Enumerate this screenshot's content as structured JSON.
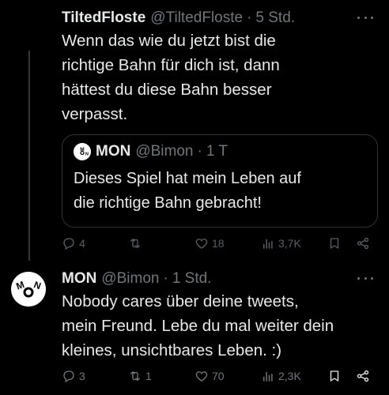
{
  "tweet1": {
    "name": "TiltedFloste",
    "handle": "@TiltedFloste",
    "dot": "·",
    "time": "5 Std.",
    "text_lines": [
      "Wenn das wie du jetzt bist die",
      "richtige Bahn für dich ist, dann",
      "hättest du diese Bahn besser",
      "verpasst."
    ],
    "quote": {
      "avatar_text": "MON",
      "name": "MON",
      "handle": "@Bimon",
      "dot": "·",
      "time": "1 T",
      "text_lines": [
        "Dieses Spiel hat mein Leben auf",
        "die richtige Bahn gebracht!"
      ]
    },
    "actions": {
      "replies": "4",
      "reposts": "",
      "likes": "18",
      "views": "3,7K"
    }
  },
  "tweet2": {
    "avatar_text": "MON",
    "name": "MON",
    "handle": "@Bimon",
    "dot": "·",
    "time": "1 Std.",
    "text_lines": [
      "Nobody cares über deine tweets,",
      "mein Freund. Lebe du mal weiter dein",
      "kleines, unsichtbares Leben. :)"
    ],
    "actions": {
      "replies": "3",
      "reposts": "1",
      "likes": "70",
      "views": "2,3K"
    }
  },
  "icons": [
    "reply-icon",
    "repost-icon",
    "like-icon",
    "views-icon",
    "bookmark-icon",
    "share-icon",
    "more-icon"
  ],
  "colors": {
    "background": "#000000",
    "text": "#e7e9ea",
    "muted": "#71767b",
    "border": "#2f3336"
  }
}
